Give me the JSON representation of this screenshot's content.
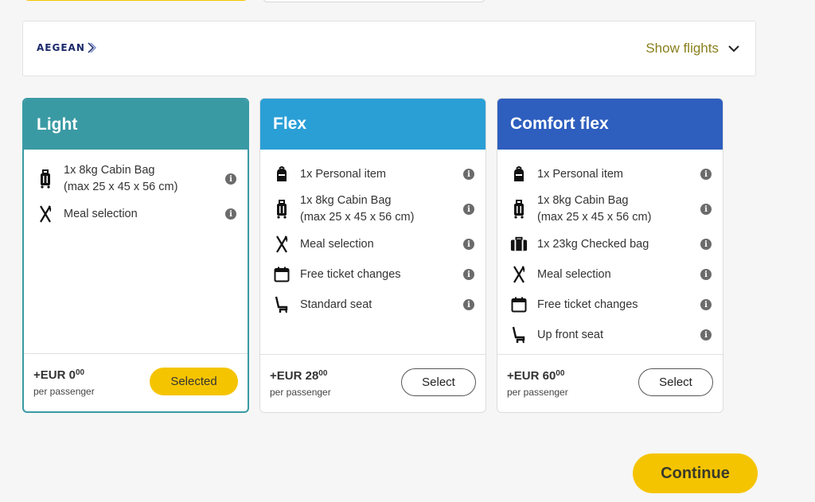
{
  "airline": {
    "name": "AEGEAN",
    "show_flights_label": "Show flights"
  },
  "fares": [
    {
      "name": "Light",
      "header_color": "#3a9aa4",
      "features": [
        {
          "icon": "cabin-bag-icon",
          "text": "1x 8kg Cabin Bag\n(max 25 x 45 x 56 cm)"
        },
        {
          "icon": "meal-icon",
          "text": "Meal selection"
        }
      ],
      "price_main": "+EUR 0",
      "price_cents": "00",
      "per_passenger": "per passenger",
      "button_label": "Selected",
      "selected": true
    },
    {
      "name": "Flex",
      "header_color": "#2a9fd6",
      "features": [
        {
          "icon": "personal-item-icon",
          "text": "1x Personal item"
        },
        {
          "icon": "cabin-bag-icon",
          "text": "1x 8kg Cabin Bag\n(max 25 x 45 x 56 cm)"
        },
        {
          "icon": "meal-icon",
          "text": "Meal selection"
        },
        {
          "icon": "calendar-icon",
          "text": "Free ticket changes"
        },
        {
          "icon": "seat-icon",
          "text": "Standard seat"
        }
      ],
      "price_main": "+EUR 28",
      "price_cents": "00",
      "per_passenger": "per passenger",
      "button_label": "Select",
      "selected": false
    },
    {
      "name": "Comfort flex",
      "header_color": "#2e5ebe",
      "features": [
        {
          "icon": "personal-item-icon",
          "text": "1x Personal item"
        },
        {
          "icon": "cabin-bag-icon",
          "text": "1x 8kg Cabin Bag\n(max 25 x 45 x 56 cm)"
        },
        {
          "icon": "checked-bag-icon",
          "text": "1x 23kg Checked bag"
        },
        {
          "icon": "meal-icon",
          "text": "Meal selection"
        },
        {
          "icon": "calendar-icon",
          "text": "Free ticket changes"
        },
        {
          "icon": "seat-icon",
          "text": "Up front seat"
        }
      ],
      "price_main": "+EUR 60",
      "price_cents": "00",
      "per_passenger": "per passenger",
      "button_label": "Select",
      "selected": false
    }
  ],
  "continue_label": "Continue",
  "colors": {
    "accent_yellow": "#f5c400",
    "link_olive": "#8a7f1c"
  }
}
